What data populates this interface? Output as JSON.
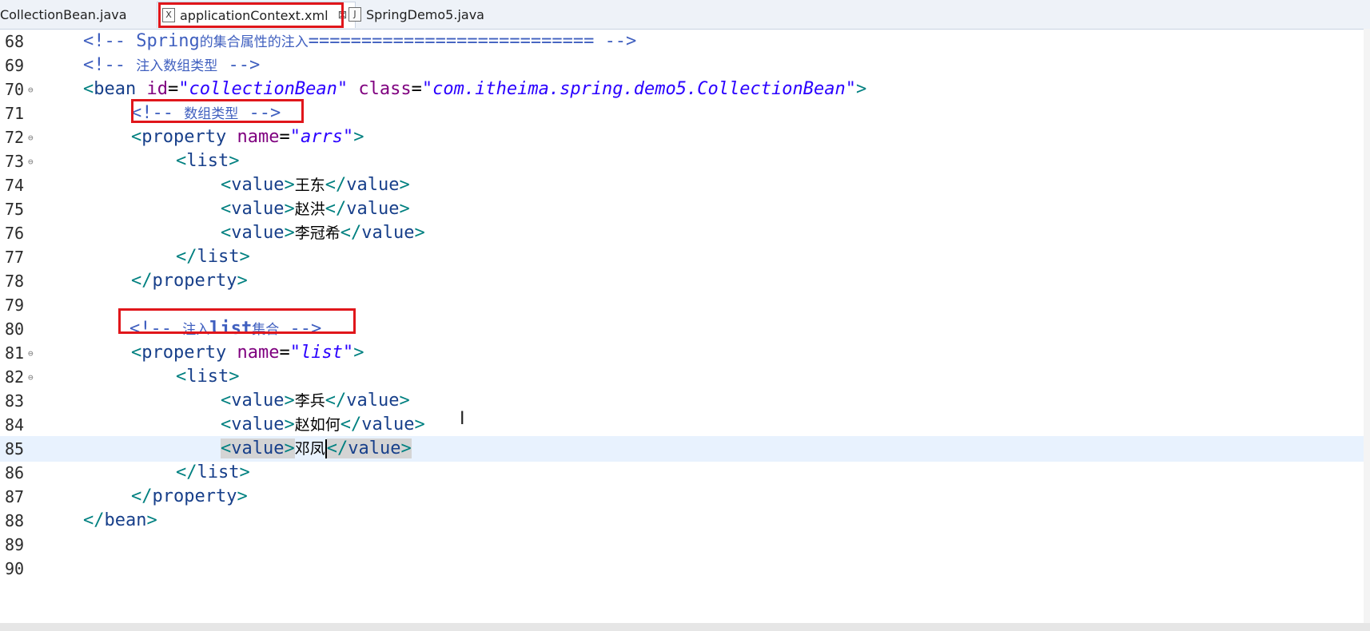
{
  "tabs": [
    {
      "label": "CollectionBean.java",
      "icon": "java-file-icon"
    },
    {
      "label": "applicationContext.xml",
      "icon": "xml-file-icon",
      "close": "⊠",
      "active": true
    },
    {
      "label": "SpringDemo5.java",
      "icon": "java-file-icon"
    }
  ],
  "editor": {
    "current_line": 85,
    "lines": [
      {
        "num": "68",
        "text": "<!-- Spring的集合属性的注入=========================== -->"
      },
      {
        "num": "69",
        "text": "<!-- 注入数组类型 -->"
      },
      {
        "num": "70",
        "text": "<bean id=\"collectionBean\" class=\"com.itheima.spring.demo5.CollectionBean\">",
        "fold": true
      },
      {
        "num": "71",
        "text": "<!-- 数组类型 -->"
      },
      {
        "num": "72",
        "text": "<property name=\"arrs\">",
        "fold": true
      },
      {
        "num": "73",
        "text": "<list>",
        "fold": true
      },
      {
        "num": "74",
        "text": "<value>王东</value>"
      },
      {
        "num": "75",
        "text": "<value>赵洪</value>"
      },
      {
        "num": "76",
        "text": "<value>李冠希</value>"
      },
      {
        "num": "77",
        "text": "</list>"
      },
      {
        "num": "78",
        "text": "</property>"
      },
      {
        "num": "79",
        "text": ""
      },
      {
        "num": "80",
        "text": "<!-- 注入list集合 -->"
      },
      {
        "num": "81",
        "text": "<property name=\"list\">",
        "fold": true
      },
      {
        "num": "82",
        "text": "<list>",
        "fold": true
      },
      {
        "num": "83",
        "text": "<value>李兵</value>"
      },
      {
        "num": "84",
        "text": "<value>赵如何</value>"
      },
      {
        "num": "85",
        "text": "<value>邓凤</value>"
      },
      {
        "num": "86",
        "text": "</list>"
      },
      {
        "num": "87",
        "text": "</property>"
      },
      {
        "num": "88",
        "text": "</bean>"
      },
      {
        "num": "89",
        "text": ""
      },
      {
        "num": "90",
        "text": ""
      }
    ]
  },
  "colors": {
    "annotation_box": "#e0161b",
    "current_line_bg": "#e8f2fe",
    "tag": "#173f8a",
    "attribute": "#7f007f",
    "string": "#2a00ff",
    "comment": "#3f5fbf"
  }
}
